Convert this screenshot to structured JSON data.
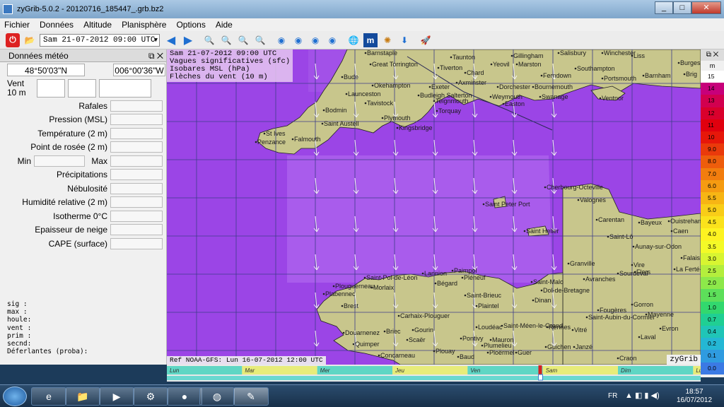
{
  "window": {
    "title": "zyGrib-5.0.2 - 20120716_185447_.grb.bz2",
    "minimize": "_",
    "maximize": "□",
    "close": "✕"
  },
  "menu": [
    "Fichier",
    "Données",
    "Altitude",
    "Planisphère",
    "Options",
    "Aide"
  ],
  "toolbar": {
    "date_value": "Sam 21-07-2012 09:00 UTC"
  },
  "panel": {
    "title": "Données météo",
    "lat": "48°50'03\"N",
    "lon": "006°00'36\"W",
    "wind_label": "Vent",
    "wind_level": "10 m",
    "fields": [
      "Rafales",
      "Pression (MSL)",
      "Température (2 m)",
      "Point de rosée (2 m)"
    ],
    "min_label": "Min",
    "max_label": "Max",
    "fields2": [
      "Précipitations",
      "Nébulosité",
      "Humidité relative (2 m)",
      "Isotherme 0°C",
      "Epaisseur de neige",
      "CAPE (surface)"
    ],
    "wave_lines": [
      "sig  :",
      "max  :",
      "houle:",
      "vent :",
      "prim :",
      "secnd:",
      "Déferlantes (proba):"
    ]
  },
  "map": {
    "info": [
      "Sam 21-07-2012 09:00 UTC",
      "Vagues significatives (sfc)",
      "Isobares MSL (hPa)",
      "Flèches du vent (10 m)"
    ],
    "ref": "Ref NOAA-GFS: Lun 16-07-2012 12:00 UTC",
    "brand": "zyGrib",
    "colors": {
      "sea": "#9b45e6",
      "land": "#c8c68c",
      "grid": "#3d3d8a"
    },
    "places": [
      {
        "n": "Barnstaple"
      },
      {
        "n": "Taunton"
      },
      {
        "n": "Gillingham"
      },
      {
        "n": "Salisbury"
      },
      {
        "n": "Winchester"
      },
      {
        "n": "Liss"
      },
      {
        "n": "Great Torrington"
      },
      {
        "n": "Tiverton"
      },
      {
        "n": "Yeovil"
      },
      {
        "n": "Marston"
      },
      {
        "n": "Burges"
      },
      {
        "n": "Bude"
      },
      {
        "n": "Chard"
      },
      {
        "n": "Ferndown"
      },
      {
        "n": "Southampton"
      },
      {
        "n": "Portsmouth"
      },
      {
        "n": "Barnham"
      },
      {
        "n": "Brig"
      },
      {
        "n": "Okehampton"
      },
      {
        "n": "Axminster"
      },
      {
        "n": "Exeter"
      },
      {
        "n": "Dorchester"
      },
      {
        "n": "Bournemouth"
      },
      {
        "n": "Launceston"
      },
      {
        "n": "Budleigh Salterton"
      },
      {
        "n": "Weymouth"
      },
      {
        "n": "Swanage"
      },
      {
        "n": "Ventnor"
      },
      {
        "n": "Tavistock"
      },
      {
        "n": "Teignmouth"
      },
      {
        "n": "Easton"
      },
      {
        "n": "Bodmin"
      },
      {
        "n": "Torquay"
      },
      {
        "n": "Plymouth"
      },
      {
        "n": "Saint Austell"
      },
      {
        "n": "Kingsbridge"
      },
      {
        "n": "St Ives"
      },
      {
        "n": "Penzance"
      },
      {
        "n": "Falmouth"
      },
      {
        "n": "Cherbourg-Octeville"
      },
      {
        "n": "Valognes"
      },
      {
        "n": "Saint Peter Port"
      },
      {
        "n": "Carentan"
      },
      {
        "n": "Bayeux"
      },
      {
        "n": "Ouistreham"
      },
      {
        "n": "Caen"
      },
      {
        "n": "Saint Helier"
      },
      {
        "n": "Saint-Lô"
      },
      {
        "n": "Aunay-sur-Odon"
      },
      {
        "n": "Falais"
      },
      {
        "n": "Granville"
      },
      {
        "n": "Vire"
      },
      {
        "n": "Flers"
      },
      {
        "n": "La Ferté-Mace"
      },
      {
        "n": "Lannion"
      },
      {
        "n": "Paimpol"
      },
      {
        "n": "Saint-Malo"
      },
      {
        "n": "Avranches"
      },
      {
        "n": "Sourdeval"
      },
      {
        "n": "Plouguerneau"
      },
      {
        "n": "Saint-Pol-de-Léon"
      },
      {
        "n": "Bégard"
      },
      {
        "n": "Pléneuf"
      },
      {
        "n": "Dol-de-Bretagne"
      },
      {
        "n": "Plabennec"
      },
      {
        "n": "Morlaix"
      },
      {
        "n": "Saint-Brieuc"
      },
      {
        "n": "Dinan"
      },
      {
        "n": "Fougères"
      },
      {
        "n": "Gorron"
      },
      {
        "n": "Mayenne"
      },
      {
        "n": "Brest"
      },
      {
        "n": "Plaintel"
      },
      {
        "n": "Saint-Aubin-du-Cormier"
      },
      {
        "n": "Carhaix-Plouguer"
      },
      {
        "n": "Saint-Méen-le-Grand"
      },
      {
        "n": "Rennes"
      },
      {
        "n": "Vitré"
      },
      {
        "n": "Evron"
      },
      {
        "n": "Douarnenez"
      },
      {
        "n": "Briec"
      },
      {
        "n": "Gourin"
      },
      {
        "n": "Loudéac"
      },
      {
        "n": "Mauron"
      },
      {
        "n": "Laval"
      },
      {
        "n": "Quimper"
      },
      {
        "n": "Scaër"
      },
      {
        "n": "Pontivy"
      },
      {
        "n": "Plumelieu"
      },
      {
        "n": "Guichen"
      },
      {
        "n": "Janzé"
      },
      {
        "n": "Concarneau"
      },
      {
        "n": "Plouay"
      },
      {
        "n": "Baud"
      },
      {
        "n": "Ploërmel"
      },
      {
        "n": "Guer"
      },
      {
        "n": "Craon"
      }
    ]
  },
  "legend": {
    "title": "m",
    "values": [
      "15",
      "14",
      "13",
      "12",
      "11",
      "10",
      "9.0",
      "8.0",
      "7.0",
      "6.0",
      "5.5",
      "5.0",
      "4.5",
      "4.0",
      "3.5",
      "3.0",
      "2.5",
      "2.0",
      "1.5",
      "1.0",
      "0.7",
      "0.4",
      "0.2",
      "0.1",
      "0.0"
    ],
    "colors": [
      "#ffffff",
      "#c7007a",
      "#d2004f",
      "#d9002c",
      "#e0000e",
      "#e6170a",
      "#ea3a0b",
      "#ee5d0c",
      "#f27d0e",
      "#f59b11",
      "#f7b514",
      "#f9cd18",
      "#fbe21c",
      "#fdf321",
      "#f4fa27",
      "#d8f531",
      "#b4ee3d",
      "#8de84a",
      "#5ddf5a",
      "#32d86e",
      "#20cf93",
      "#20c5b7",
      "#24b7d4",
      "#2f9be0",
      "#3b7ae4"
    ]
  },
  "timeline": {
    "days": [
      "Lun",
      "Mar",
      "Mer",
      "Jeu",
      "Ven",
      "Sam",
      "Dim",
      "Lun"
    ],
    "cursor_fraction": 0.7
  },
  "taskbar": {
    "lang": "FR",
    "time": "18:57",
    "date": "16/07/2012"
  }
}
